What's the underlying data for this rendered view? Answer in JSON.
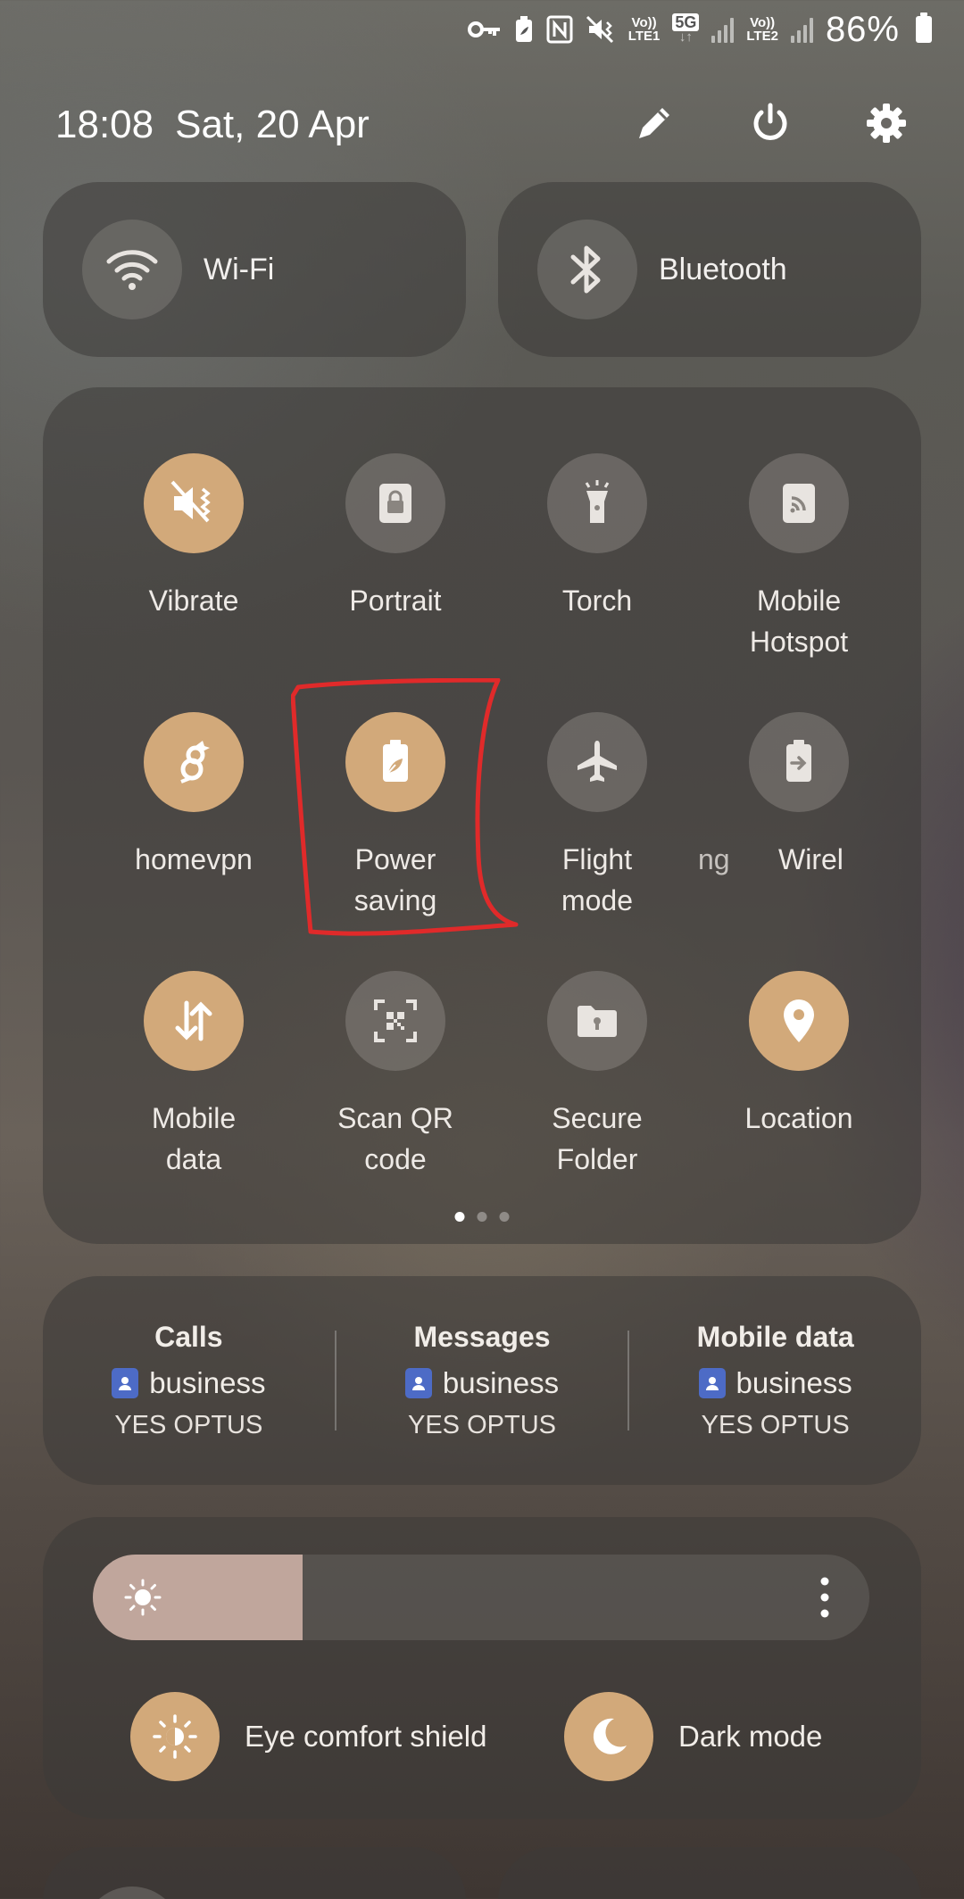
{
  "status_bar": {
    "volte1": "Vo))",
    "lte1": "LTE1",
    "net_badge": "5G",
    "volte2": "Vo))",
    "lte2": "LTE2",
    "battery": "86%"
  },
  "header": {
    "time": "18:08",
    "date": "Sat, 20 Apr"
  },
  "connectivity": [
    {
      "label": "Wi-Fi",
      "icon": "wifi-icon"
    },
    {
      "label": "Bluetooth",
      "icon": "bluetooth-icon"
    }
  ],
  "tiles": [
    {
      "label": "Vibrate",
      "icon": "vibrate-icon",
      "active": true
    },
    {
      "label": "Portrait",
      "icon": "portrait-lock-icon",
      "active": false
    },
    {
      "label": "Torch",
      "icon": "torch-icon",
      "active": false
    },
    {
      "label": "Mobile\nHotspot",
      "icon": "hotspot-icon",
      "active": false
    },
    {
      "label": "homevpn",
      "icon": "wireguard-icon",
      "active": true
    },
    {
      "label": "Power\nsaving",
      "icon": "power-saving-icon",
      "active": true
    },
    {
      "label": "Flight\nmode",
      "icon": "airplane-icon",
      "active": false
    },
    {
      "label_left": "ng",
      "label_right": "Wirel",
      "icon": "wireless-share-icon",
      "active": false
    },
    {
      "label": "Mobile\ndata",
      "icon": "mobile-data-icon",
      "active": true
    },
    {
      "label": "Scan QR\ncode",
      "icon": "qr-scan-icon",
      "active": false
    },
    {
      "label": "Secure\nFolder",
      "icon": "secure-folder-icon",
      "active": false
    },
    {
      "label": "Location",
      "icon": "location-icon",
      "active": true
    }
  ],
  "pagination": {
    "pages": 3,
    "current": 0
  },
  "sim": [
    {
      "title": "Calls",
      "profile": "business",
      "carrier": "YES OPTUS"
    },
    {
      "title": "Messages",
      "profile": "business",
      "carrier": "YES OPTUS"
    },
    {
      "title": "Mobile data",
      "profile": "business",
      "carrier": "YES OPTUS"
    }
  ],
  "brightness": {
    "level": 0.27
  },
  "toggles": [
    {
      "label": "Eye comfort shield",
      "icon": "eye-comfort-icon"
    },
    {
      "label": "Dark mode",
      "icon": "moon-icon"
    }
  ],
  "colors": {
    "accent": "#d2a97a",
    "highlight": "#e02a2a",
    "sim_badge": "#4d6bc6"
  }
}
